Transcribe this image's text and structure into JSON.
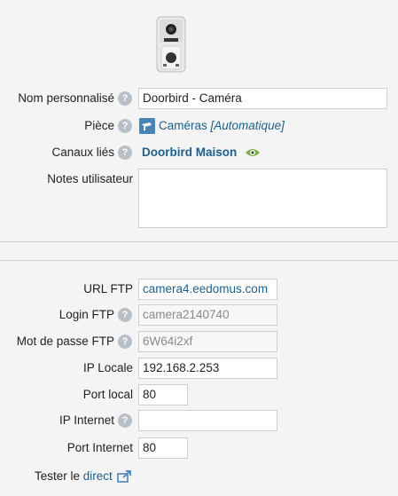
{
  "device": {
    "name_label": "Nom personnalisé",
    "name_value": "Doorbird - Caméra",
    "room_label": "Pièce",
    "room_name": "Caméras",
    "room_auto": "[Automatique]",
    "channels_label": "Canaux liés",
    "channels_value": "Doorbird Maison",
    "notes_label": "Notes utilisateur",
    "notes_value": ""
  },
  "ftp": {
    "url_label": "URL FTP",
    "url_value": "camera4.eedomus.com",
    "login_label": "Login FTP",
    "login_value": "camera2140740",
    "password_label": "Mot de passe FTP",
    "password_value": "6W64i2xf",
    "ip_local_label": "IP Locale",
    "ip_local_value": "192.168.2.253",
    "port_local_label": "Port local",
    "port_local_value": "80",
    "ip_internet_label": "IP Internet",
    "ip_internet_value": "",
    "port_internet_label": "Port Internet",
    "port_internet_value": "80",
    "test_prefix": "Tester le",
    "test_link": "direct"
  },
  "icons": {
    "help": "question-mark-icon",
    "room": "camera-room-icon",
    "eye": "eye-icon",
    "external": "external-link-icon"
  },
  "colors": {
    "link": "#1d5f8c",
    "help_bg": "#b9bfc6"
  }
}
